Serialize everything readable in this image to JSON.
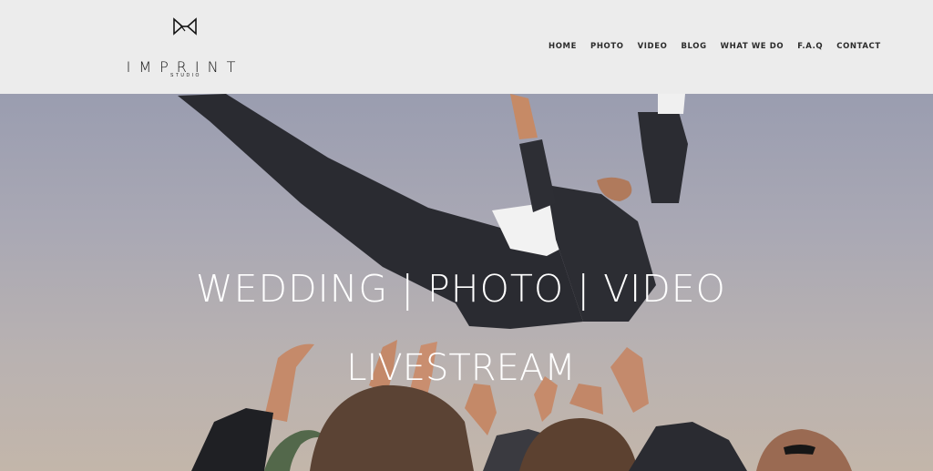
{
  "brand": {
    "name": "IMPRINT",
    "tagline": "STUDIO"
  },
  "nav": {
    "items": [
      {
        "label": "HOME"
      },
      {
        "label": "PHOTO"
      },
      {
        "label": "VIDEO"
      },
      {
        "label": "BLOG"
      },
      {
        "label": "WHAT WE DO"
      },
      {
        "label": "F.A.Q"
      },
      {
        "label": "CONTACT"
      }
    ]
  },
  "hero": {
    "headline": "WEDDING | PHOTO | VIDEO",
    "subheadline": "LIVESTREAM"
  },
  "colors": {
    "header_bg": "#ececec",
    "nav_text": "#2b2b2b",
    "hero_text": "#ffffff"
  }
}
